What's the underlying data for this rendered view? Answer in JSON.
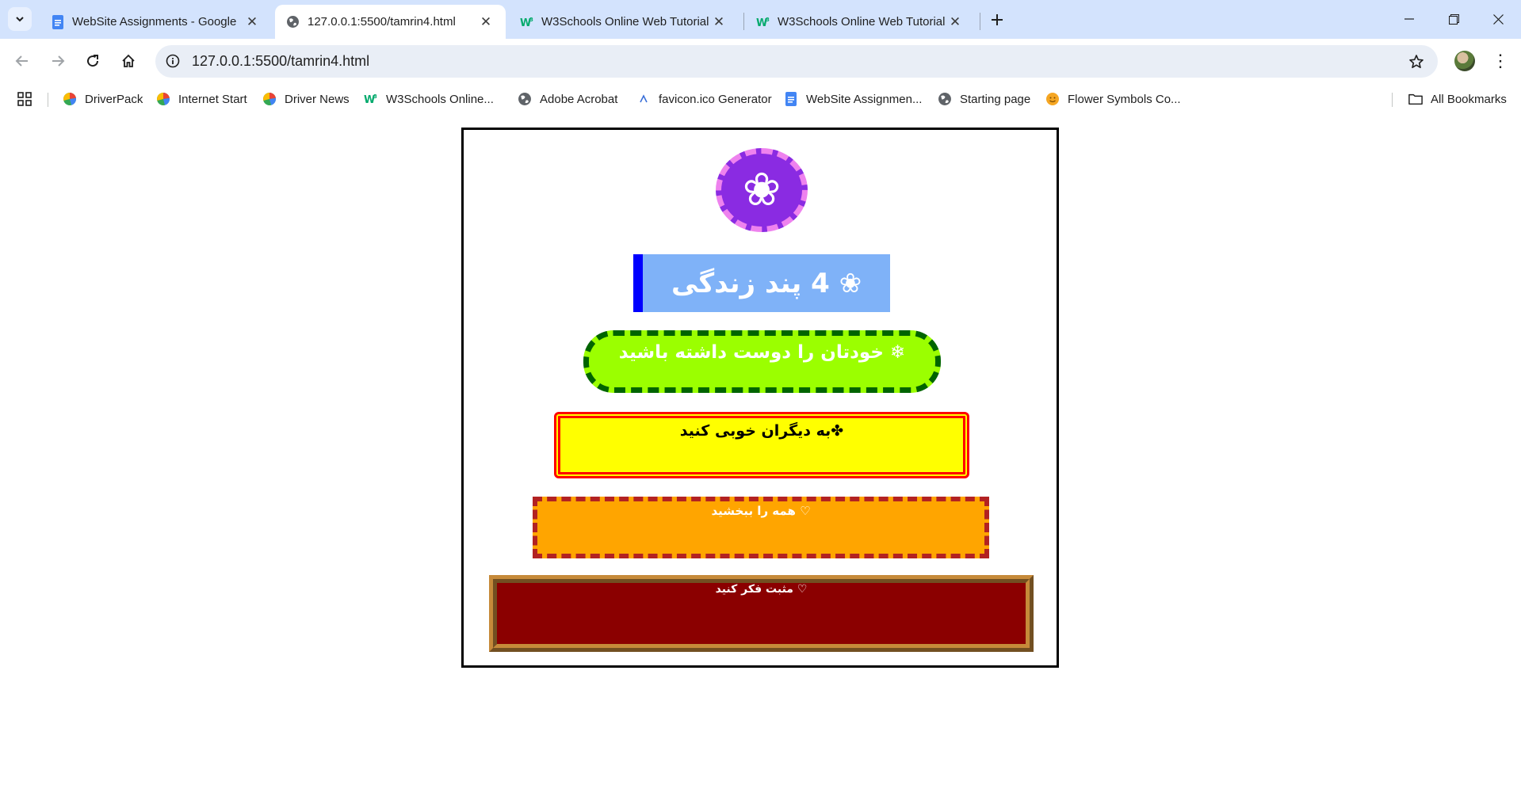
{
  "browser": {
    "tabs": [
      {
        "title": "WebSite Assignments - Google",
        "favicon": "google-docs-icon",
        "active": false
      },
      {
        "title": "127.0.0.1:5500/tamrin4.html",
        "favicon": "globe-icon",
        "active": true
      },
      {
        "title": "W3Schools Online Web Tutorial",
        "favicon": "w3schools-icon",
        "active": false
      },
      {
        "title": "W3Schools Online Web Tutorial",
        "favicon": "w3schools-icon",
        "active": false
      }
    ],
    "address": {
      "url": "127.0.0.1:5500/tamrin4.html"
    },
    "bookmarks": [
      {
        "label": "DriverPack",
        "icon": "driverpack-icon"
      },
      {
        "label": "Internet Start",
        "icon": "driverpack-icon"
      },
      {
        "label": "Driver News",
        "icon": "driverpack-icon"
      },
      {
        "label": "W3Schools Online...",
        "icon": "w3schools-icon"
      },
      {
        "label": "Adobe Acrobat",
        "icon": "globe-icon"
      },
      {
        "label": "favicon.ico Generator",
        "icon": "favicon-generator-icon"
      },
      {
        "label": "WebSite Assignmen...",
        "icon": "google-docs-icon"
      },
      {
        "label": "Starting page",
        "icon": "globe-icon"
      },
      {
        "label": "Flower Symbols Co...",
        "icon": "emoji-icon"
      }
    ],
    "all_bookmarks_label": "All Bookmarks"
  },
  "page": {
    "badge_symbol": "❀",
    "title": "❀ 4 پند زندگی",
    "items": [
      "❄ خودتان را دوست داشته باشید",
      "✤به دیگران خوبی کنید",
      "♡ همه را ببخشید",
      "♡ مثبت فکر کنید"
    ]
  },
  "colors": {
    "tabstrip_bg": "#d3e3fd",
    "badge_bg": "#8a2be2",
    "badge_border": "#ee82ee",
    "title_bg": "#7fb2f8",
    "title_accent": "#0000ff",
    "item1_bg": "#9bff00",
    "item1_border": "#006400",
    "item2_bg": "#ffff00",
    "item2_border": "#ff0000",
    "item3_bg": "#ffa500",
    "item3_border": "#b22222",
    "item4_bg": "#8b0000",
    "item4_border": "#c68a3a"
  }
}
